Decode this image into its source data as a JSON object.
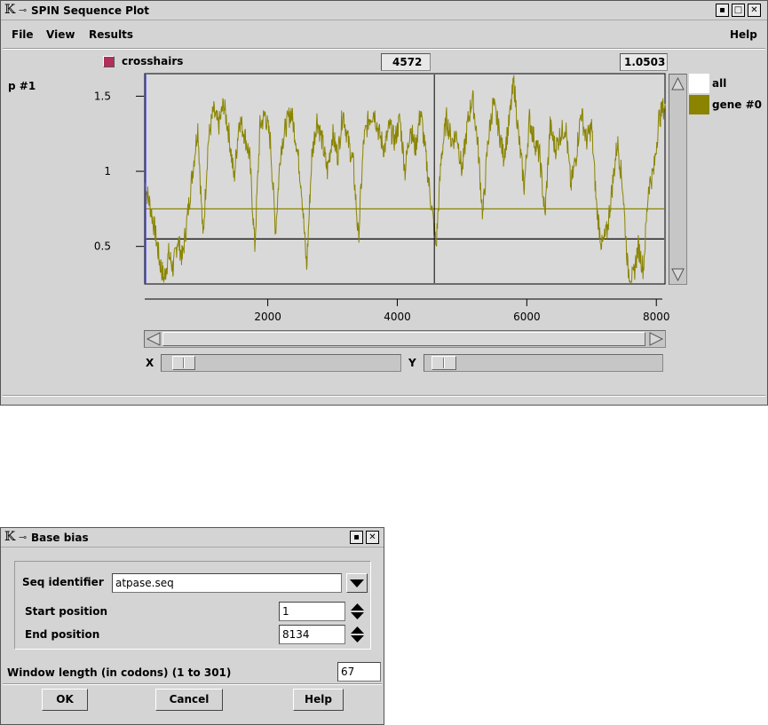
{
  "plot_window": {
    "title": "SPIN Sequence Plot",
    "menu": {
      "file": "File",
      "view": "View",
      "results": "Results",
      "help": "Help"
    },
    "crosshairs_label": "crosshairs",
    "crosshair_x": "4572",
    "crosshair_y": "1.0503",
    "plot_label": "p #1",
    "legend": [
      {
        "label": "all",
        "color": "#ffffff"
      },
      {
        "label": "gene #0",
        "color": "#8a8400"
      }
    ],
    "x_slider_label": "X",
    "y_slider_label": "Y",
    "plot_background": "#d9d9d9",
    "series_color": "#8a8400"
  },
  "chart_data": {
    "type": "line",
    "xlim": [
      100,
      8134
    ],
    "ylim": [
      0.25,
      1.65
    ],
    "x_ticks": [
      2000,
      4000,
      6000,
      8000
    ],
    "x_tick_labels": [
      "2000",
      "4000",
      "6000",
      "8000"
    ],
    "y_ticks": [
      0.5,
      1,
      1.5
    ],
    "y_tick_labels": [
      "0.5",
      "1",
      "1.5"
    ],
    "crosshair": {
      "x": 4572,
      "y": 1.0503
    },
    "series": [
      {
        "x": [
          100,
          180,
          260,
          330,
          400,
          470,
          540,
          610,
          680,
          760,
          840,
          920,
          1000,
          1080,
          1160,
          1240,
          1320,
          1400,
          1480,
          1560,
          1640,
          1720,
          1800,
          1880,
          1960,
          2040,
          2120,
          2200,
          2280,
          2360,
          2440,
          2520,
          2600,
          2680,
          2760,
          2840,
          2920,
          3000,
          3080,
          3160,
          3240,
          3320,
          3400,
          3480,
          3560,
          3640,
          3720,
          3800,
          3880,
          3960,
          4040,
          4120,
          4200,
          4280,
          4360,
          4440,
          4520,
          4600,
          4680,
          4760,
          4840,
          4920,
          5000,
          5080,
          5160,
          5240,
          5320,
          5400,
          5480,
          5560,
          5640,
          5720,
          5800,
          5880,
          5960,
          6040,
          6120,
          6200,
          6280,
          6360,
          6440,
          6520,
          6600,
          6680,
          6760,
          6840,
          6920,
          7000,
          7080,
          7160,
          7240,
          7320,
          7400,
          7480,
          7560,
          7640,
          7720,
          7800,
          7880,
          7960,
          8040,
          8134
        ],
        "y": [
          0.92,
          0.78,
          0.6,
          0.4,
          0.28,
          0.45,
          0.35,
          0.55,
          0.42,
          0.7,
          1.0,
          1.3,
          0.55,
          1.2,
          1.4,
          1.3,
          1.45,
          1.25,
          0.95,
          1.35,
          1.25,
          1.1,
          0.5,
          1.3,
          1.38,
          1.2,
          0.6,
          1.15,
          1.3,
          1.4,
          1.2,
          0.9,
          0.35,
          1.1,
          1.35,
          1.2,
          1.0,
          1.25,
          1.1,
          1.4,
          1.2,
          1.05,
          0.55,
          1.2,
          1.35,
          1.4,
          1.25,
          1.15,
          1.3,
          1.2,
          1.35,
          1.0,
          1.3,
          1.15,
          1.4,
          1.1,
          0.8,
          0.5,
          1.1,
          1.35,
          1.2,
          1.25,
          1.0,
          1.3,
          1.5,
          1.2,
          0.7,
          1.2,
          1.45,
          1.3,
          1.1,
          1.3,
          1.6,
          1.2,
          0.9,
          1.35,
          1.2,
          1.1,
          0.7,
          1.3,
          1.15,
          1.25,
          1.3,
          0.9,
          1.1,
          1.4,
          1.2,
          1.3,
          0.75,
          0.5,
          0.6,
          0.9,
          1.2,
          0.9,
          0.35,
          0.28,
          0.5,
          0.35,
          0.9,
          1.0,
          1.35,
          1.45
        ]
      }
    ],
    "reference_lines": [
      {
        "y": 0.55,
        "color": "#000000"
      },
      {
        "y": 0.75,
        "color": "#8a8400"
      }
    ]
  },
  "base_window": {
    "title": "Base bias",
    "seq_id_label": "Seq identifier",
    "seq_id_value": "atpase.seq",
    "start_label": "Start position",
    "start_value": "1",
    "end_label": "End position",
    "end_value": "8134",
    "window_label": "Window length (in codons) (1 to 301)",
    "window_value": "67",
    "ok": "OK",
    "cancel": "Cancel",
    "help": "Help"
  }
}
